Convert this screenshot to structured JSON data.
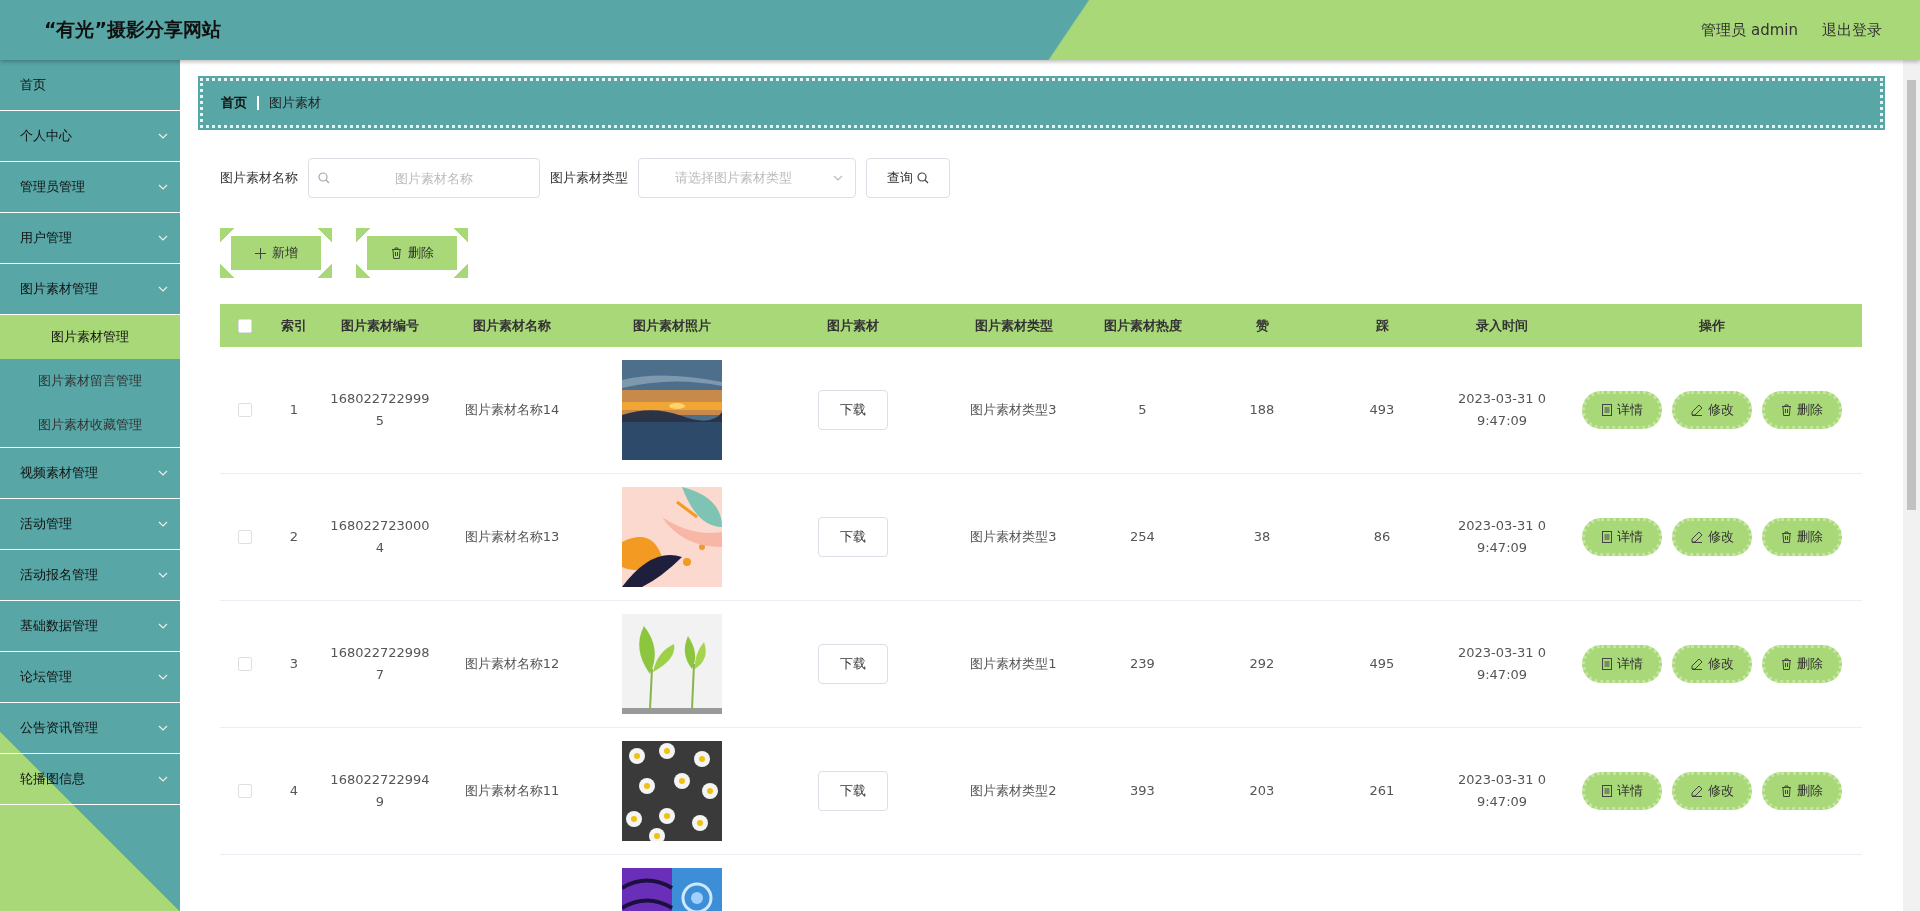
{
  "header": {
    "title": "“有光”摄影分享网站",
    "user": "管理员 admin",
    "logout": "退出登录"
  },
  "sidebar": {
    "items": [
      {
        "label": "首页",
        "expandable": false,
        "selected": false
      },
      {
        "label": "个人中心",
        "expandable": true,
        "selected": false
      },
      {
        "label": "管理员管理",
        "expandable": true,
        "selected": false
      },
      {
        "label": "用户管理",
        "expandable": true,
        "selected": false
      },
      {
        "label": "图片素材管理",
        "expandable": true,
        "selected": false,
        "children": [
          {
            "label": "图片素材管理",
            "selected": true
          },
          {
            "label": "图片素材留言管理",
            "selected": false
          },
          {
            "label": "图片素材收藏管理",
            "selected": false
          }
        ]
      },
      {
        "label": "视频素材管理",
        "expandable": true,
        "selected": false
      },
      {
        "label": "活动管理",
        "expandable": true,
        "selected": false
      },
      {
        "label": "活动报名管理",
        "expandable": true,
        "selected": false
      },
      {
        "label": "基础数据管理",
        "expandable": true,
        "selected": false
      },
      {
        "label": "论坛管理",
        "expandable": true,
        "selected": false
      },
      {
        "label": "公告资讯管理",
        "expandable": true,
        "selected": false
      },
      {
        "label": "轮播图信息",
        "expandable": true,
        "selected": false
      }
    ]
  },
  "breadcrumb": [
    "首页",
    "图片素材"
  ],
  "search": {
    "name_label": "图片素材名称",
    "name_placeholder": "图片素材名称",
    "type_label": "图片素材类型",
    "type_placeholder": "请选择图片素材类型",
    "query_button": "查询"
  },
  "actions": [
    "新增",
    "删除"
  ],
  "table": {
    "columns": [
      "索引",
      "图片素材编号",
      "图片素材名称",
      "图片素材照片",
      "图片素材",
      "图片素材类型",
      "图片素材热度",
      "赞",
      "踩",
      "录入时间",
      "操作"
    ],
    "all_checked": false,
    "rows": [
      {
        "kind": "full",
        "checked": false,
        "index": "1",
        "code": "1680227229995",
        "name": "图片素材名称14",
        "download": "下载",
        "type": "图片素材类型3",
        "heat": "5",
        "likes": "188",
        "dislikes": "493",
        "time": "2023-03-31 09:47:09",
        "buttons": [
          "详情",
          "修改",
          "删除"
        ]
      },
      {
        "kind": "full",
        "checked": false,
        "index": "2",
        "code": "1680227230004",
        "name": "图片素材名称13",
        "download": "下载",
        "type": "图片素材类型3",
        "heat": "254",
        "likes": "38",
        "dislikes": "86",
        "time": "2023-03-31 09:47:09",
        "buttons": [
          "详情",
          "修改",
          "删除"
        ]
      },
      {
        "kind": "full",
        "checked": false,
        "index": "3",
        "code": "1680227229987",
        "name": "图片素材名称12",
        "download": "下载",
        "type": "图片素材类型1",
        "heat": "239",
        "likes": "292",
        "dislikes": "495",
        "time": "2023-03-31 09:47:09",
        "buttons": [
          "详情",
          "修改",
          "删除"
        ]
      },
      {
        "kind": "full",
        "checked": false,
        "index": "4",
        "code": "1680227229949",
        "name": "图片素材名称11",
        "download": "下载",
        "type": "图片素材类型2",
        "heat": "393",
        "likes": "203",
        "dislikes": "261",
        "time": "2023-03-31 09:47:09",
        "buttons": [
          "详情",
          "修改",
          "删除"
        ]
      },
      {
        "kind": "cut"
      }
    ]
  }
}
